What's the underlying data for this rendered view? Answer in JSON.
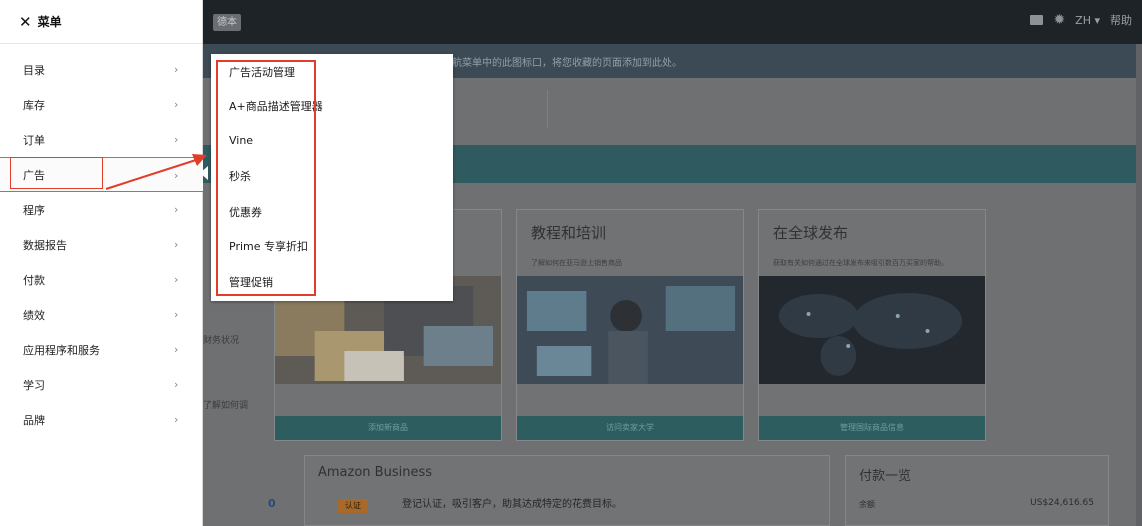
{
  "menu": {
    "title": "菜单",
    "close_glyph": "✕",
    "chevron_glyph": "›",
    "items": [
      {
        "label": "目录"
      },
      {
        "label": "库存"
      },
      {
        "label": "订单"
      },
      {
        "label": "广告",
        "active": true
      },
      {
        "label": "程序"
      },
      {
        "label": "数据报告"
      },
      {
        "label": "付款"
      },
      {
        "label": "绩效"
      },
      {
        "label": "应用程序和服务"
      },
      {
        "label": "学习"
      },
      {
        "label": "品牌"
      }
    ]
  },
  "submenu": {
    "items": [
      {
        "label": "广告活动管理"
      },
      {
        "label": "A+商品描述管理器"
      },
      {
        "label": "Vine"
      },
      {
        "label": "秒杀"
      },
      {
        "label": "优惠券"
      },
      {
        "label": "Prime 专享折扣"
      },
      {
        "label": "管理促销"
      }
    ]
  },
  "header": {
    "tag": "德本",
    "language": "ZH ▾",
    "help": "帮助",
    "icons": [
      "mail-icon",
      "gear-icon"
    ]
  },
  "notice": {
    "text": "航菜单中的此图标口，将您收藏的页面添加到此处。"
  },
  "cards": [
    {
      "title": "教程和培训",
      "subtitle": "了解如何在亚马逊上销售商品",
      "button": "访问卖家大学"
    },
    {
      "title": "在全球发布",
      "subtitle": "获取有关如何通过在全球发布来吸引数百万买家的帮助。",
      "button": "管理国际商品信息"
    }
  ],
  "first_card": {
    "button": "添加新商品"
  },
  "left_fragments": {
    "a": "财务状况",
    "b": "了解如何调"
  },
  "amazon_business": {
    "title": "Amazon Business",
    "badge": "认证",
    "description": "登记认证，吸引客户，助其达成特定的花费目标。"
  },
  "payment": {
    "title": "付款一览",
    "label": "余额",
    "value": "US$24,616.65"
  },
  "counter": "0",
  "colors": {
    "highlight_red": "#e23d29",
    "teal": "#2f5a5f",
    "topbar": "#1d2327"
  }
}
